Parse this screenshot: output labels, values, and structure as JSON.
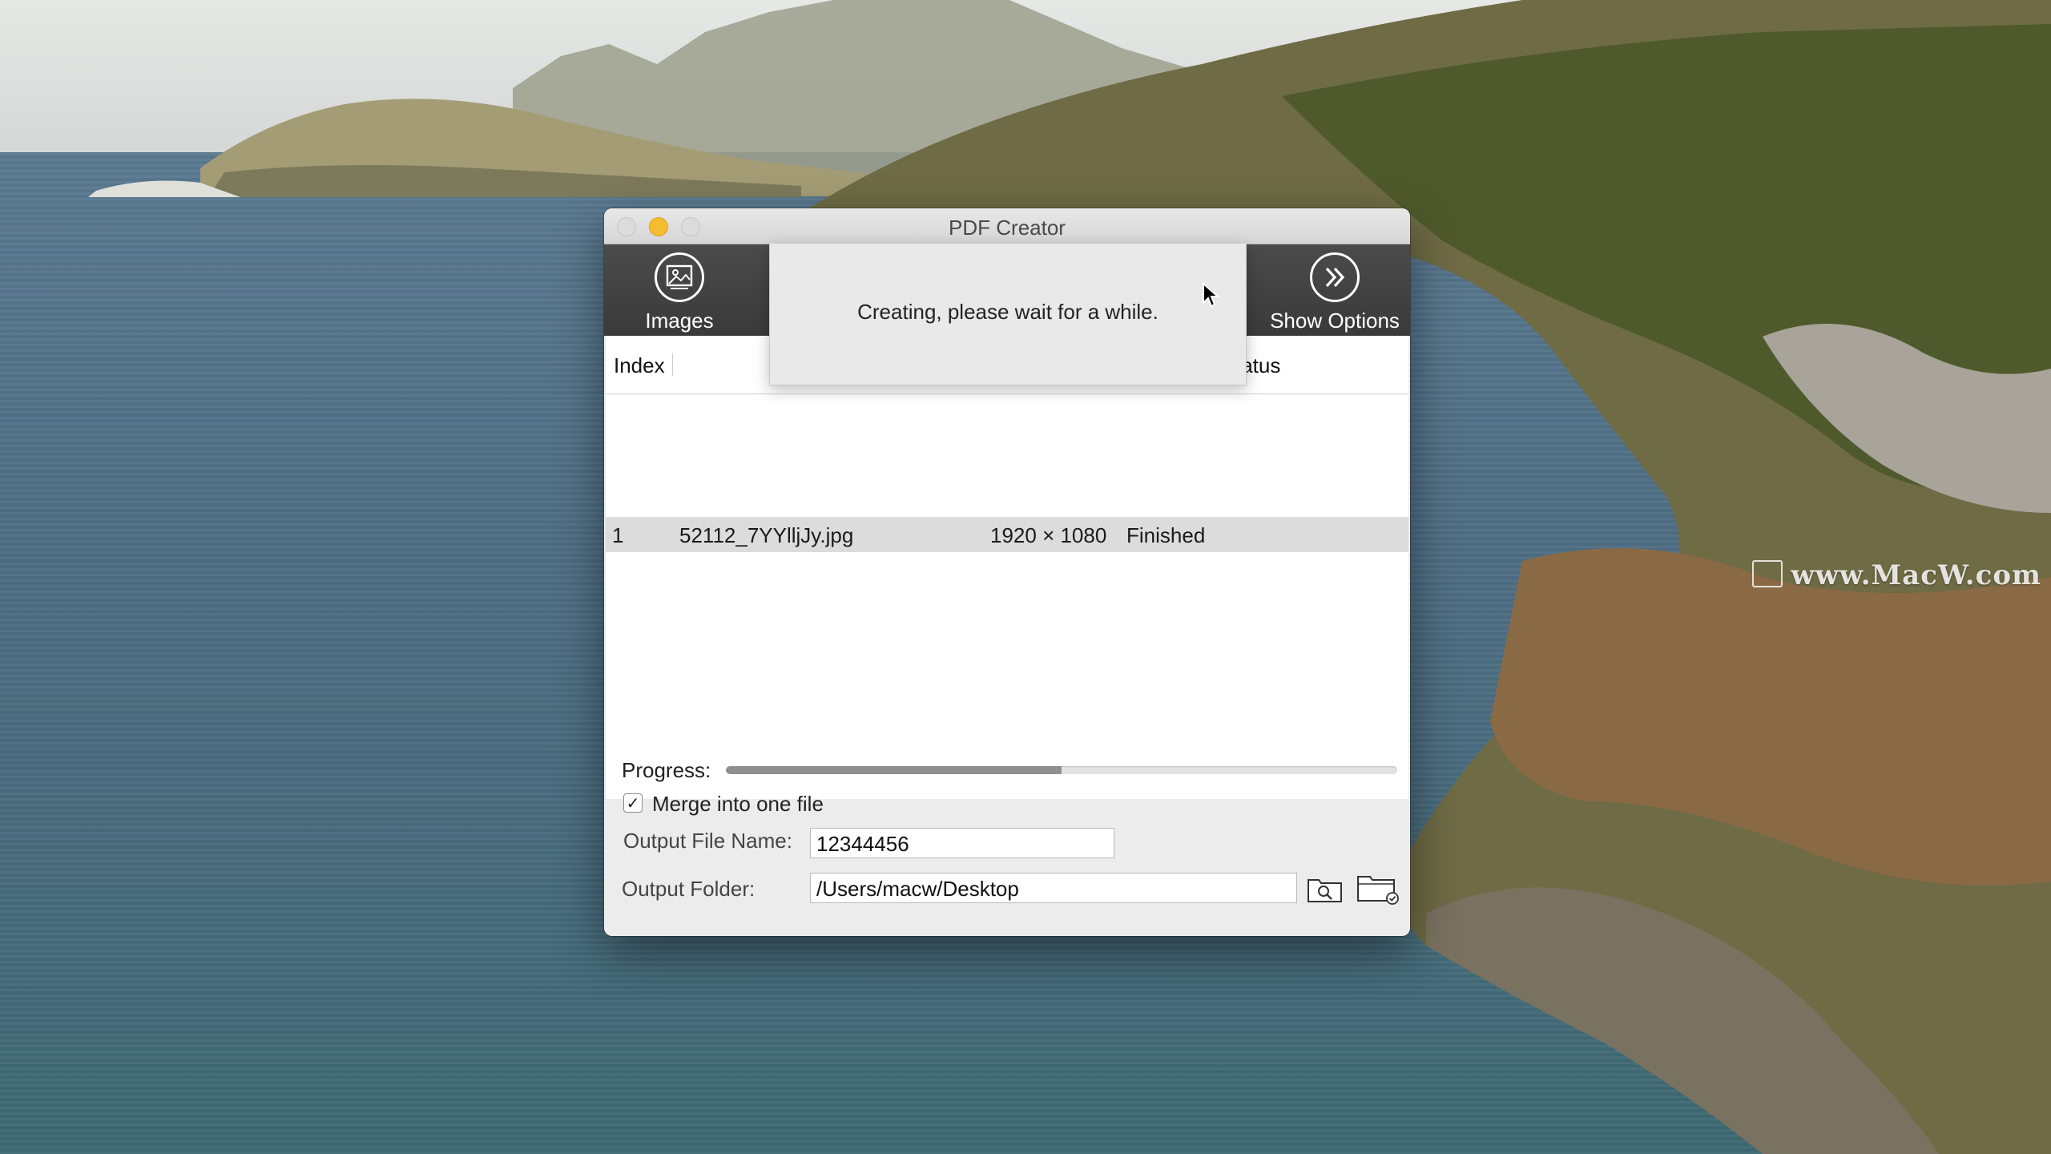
{
  "window": {
    "title": "PDF Creator"
  },
  "toolbar": {
    "images_label": "Images",
    "show_options_label": "Show Options"
  },
  "table": {
    "headers": {
      "index": "Index",
      "status": "tatus"
    },
    "rows": [
      {
        "index": "1",
        "name": "52112_7YYlljJy.jpg",
        "size": "1920 × 1080",
        "status": "Finished"
      }
    ]
  },
  "sheet": {
    "message": "Creating, please wait for a while."
  },
  "bottom": {
    "progress_label": "Progress:",
    "progress_fraction": 0.5,
    "merge_label": "Merge into one file",
    "merge_checked": true,
    "output_name_label": "Output File Name:",
    "output_name_value": "12344456",
    "output_folder_label": "Output Folder:",
    "output_folder_value": "/Users/macw/Desktop"
  },
  "desktop": {
    "watermark": "www.MacW.com"
  },
  "icons": {
    "images": "image-icon",
    "options": "double-chevron-right-icon",
    "browse": "folder-search-icon",
    "open_folder": "folder-check-icon",
    "checkmark": "✓"
  }
}
